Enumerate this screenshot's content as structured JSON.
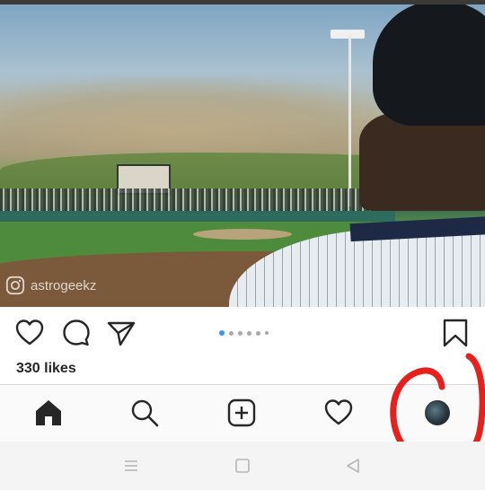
{
  "post": {
    "watermark_text": "astrogeekz",
    "likes_text": "330 likes",
    "carousel": {
      "count": 6,
      "active_index": 0
    }
  },
  "actions": {
    "like_icon": "heart-outline-icon",
    "comment_icon": "comment-bubble-icon",
    "share_icon": "paper-plane-icon",
    "save_icon": "bookmark-icon"
  },
  "nav": {
    "items": [
      "home-icon",
      "search-icon",
      "add-post-icon",
      "activity-heart-icon",
      "profile-avatar"
    ],
    "active": "home-icon"
  },
  "system_nav": [
    "menu-icon",
    "home-square-icon",
    "back-triangle-icon"
  ],
  "colors": {
    "accent_blue": "#3897f0",
    "annotation_red": "#e8201c",
    "text_primary": "#262626"
  }
}
